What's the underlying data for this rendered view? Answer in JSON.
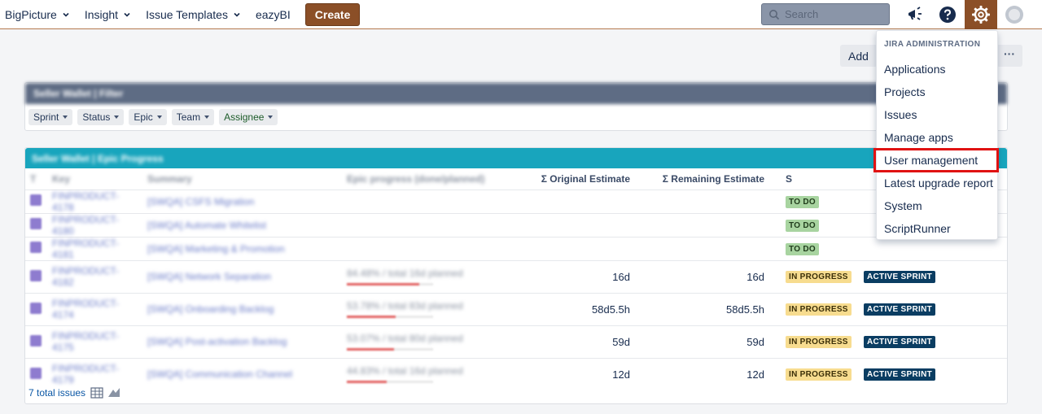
{
  "nav": {
    "items": [
      {
        "label": "BigPicture",
        "has_menu": true
      },
      {
        "label": "Insight",
        "has_menu": true
      },
      {
        "label": "Issue Templates",
        "has_menu": true
      },
      {
        "label": "eazyBI",
        "has_menu": false
      }
    ],
    "create_label": "Create",
    "search_placeholder": "Search",
    "icons": [
      "megaphone-icon",
      "help-icon",
      "gear-icon",
      "avatar"
    ]
  },
  "toolbar": {
    "add_gadget_label": "Add g",
    "more_label": "···"
  },
  "filter_gadget": {
    "title": "Seller Wallet | Filter",
    "chips": [
      "Sprint",
      "Status",
      "Epic",
      "Team",
      "Assignee"
    ]
  },
  "epic_gadget": {
    "title": "Seller Wallet | Epic Progress",
    "columns": [
      "T",
      "Key",
      "Summary",
      "Epic progress (done/planned)",
      "Σ Original Estimate",
      "Σ Remaining Estimate",
      "S"
    ],
    "rows": [
      {
        "key": "FINPRODUCT-4178",
        "summary": "[SWQA] CSFS Migration",
        "progress": "",
        "orig": "",
        "remain": "",
        "status": "TO DO",
        "sprint": ""
      },
      {
        "key": "FINPRODUCT-4180",
        "summary": "[SWQA] Automate Whitelist",
        "progress": "",
        "orig": "",
        "remain": "",
        "status": "TO DO",
        "sprint": ""
      },
      {
        "key": "FINPRODUCT-4181",
        "summary": "[SWQA] Marketing & Promotion",
        "progress": "",
        "orig": "",
        "remain": "",
        "status": "TO DO",
        "sprint": ""
      },
      {
        "key": "FINPRODUCT-4182",
        "summary": "[SWQA] Network Separation",
        "progress": "84.48% / total 16d planned",
        "progress_value": 0.84,
        "orig": "16d",
        "remain": "16d",
        "status": "IN PROGRESS",
        "sprint": "ACTIVE SPRINT"
      },
      {
        "key": "FINPRODUCT-4174",
        "summary": "[SWQA] Onboarding Backlog",
        "progress": "53.78% / total 83d planned",
        "progress_value": 0.57,
        "orig": "58d5.5h",
        "remain": "58d5.5h",
        "status": "IN PROGRESS",
        "sprint": "ACTIVE SPRINT"
      },
      {
        "key": "FINPRODUCT-4175",
        "summary": "[SWQA] Post-activation Backlog",
        "progress": "53.07% / total 80d planned",
        "progress_value": 0.55,
        "orig": "59d",
        "remain": "59d",
        "status": "IN PROGRESS",
        "sprint": "ACTIVE SPRINT"
      },
      {
        "key": "FINPRODUCT-4179",
        "summary": "[SWQA] Communication Channel",
        "progress": "44.83% / total 16d planned",
        "progress_value": 0.46,
        "orig": "12d",
        "remain": "12d",
        "status": "IN PROGRESS",
        "sprint": "ACTIVE SPRINT"
      }
    ],
    "footer": "7 total issues"
  },
  "admin_menu": {
    "heading": "JIRA ADMINISTRATION",
    "items": [
      "Applications",
      "Projects",
      "Issues",
      "Manage apps",
      "User management",
      "Latest upgrade report",
      "System",
      "ScriptRunner"
    ],
    "highlighted": "User management"
  },
  "colors": {
    "brand": "#8b4f27",
    "filter_header": "#5e6c84",
    "epic_header": "#18a5bd",
    "highlight_outline": "#e01212"
  }
}
